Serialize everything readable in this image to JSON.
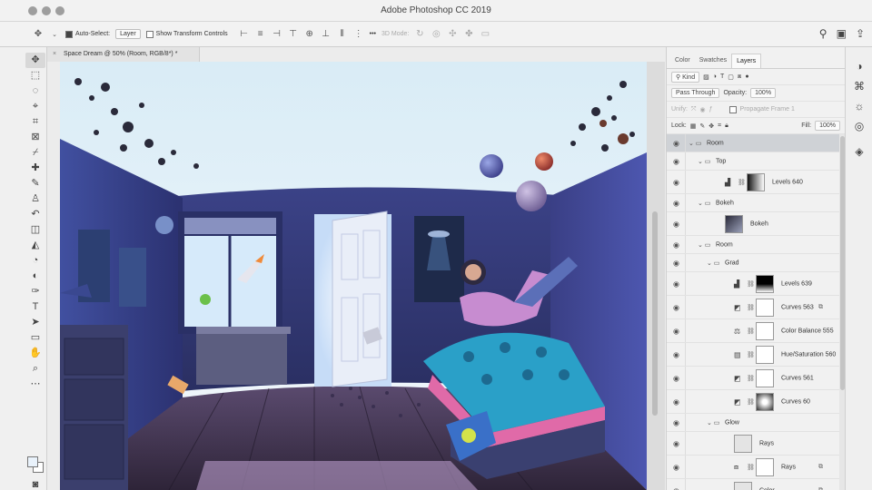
{
  "window": {
    "title": "Adobe Photoshop CC 2019"
  },
  "options_bar": {
    "auto_select_label": "Auto-Select:",
    "auto_select_value": "Layer",
    "show_transform_label": "Show Transform Controls",
    "mode_label": "3D Mode:",
    "more": "•••"
  },
  "document": {
    "tab_title": "Space Dream @ 50% (Room, RGB/8*) *"
  },
  "panel_tabs": [
    "Color",
    "Swatches",
    "Layers"
  ],
  "layers_panel": {
    "filter_label": "Kind",
    "blend_mode": "Pass Through",
    "opacity_label": "Opacity:",
    "opacity_value": "100%",
    "unify_label": "Unify:",
    "propagate_label": "Propagate Frame 1",
    "lock_label": "Lock:",
    "fill_label": "Fill:",
    "fill_value": "100%"
  },
  "layers": [
    {
      "name": "Room",
      "kind": "group",
      "depth": 0,
      "selected": true
    },
    {
      "name": "Top",
      "kind": "group",
      "depth": 1
    },
    {
      "name": "Levels 640",
      "kind": "adjustment",
      "icon": "levels-icon",
      "depth": 2,
      "thumb": "gradient"
    },
    {
      "name": "Bokeh",
      "kind": "group",
      "depth": 1
    },
    {
      "name": "Bokeh",
      "kind": "pixel",
      "depth": 2,
      "thumb": "image"
    },
    {
      "name": "Room",
      "kind": "group",
      "depth": 1
    },
    {
      "name": "Grad",
      "kind": "group",
      "depth": 2
    },
    {
      "name": "Levels 639",
      "kind": "adjustment",
      "icon": "levels-icon",
      "depth": 3,
      "thumb": "black-gradient"
    },
    {
      "name": "Curves 563",
      "kind": "adjustment",
      "icon": "curves-icon",
      "depth": 3,
      "thumb": "white",
      "fx": true
    },
    {
      "name": "Color Balance 555",
      "kind": "adjustment",
      "icon": "color-balance-icon",
      "depth": 3,
      "thumb": "white"
    },
    {
      "name": "Hue/Saturation 560",
      "kind": "adjustment",
      "icon": "hue-saturation-icon",
      "depth": 3,
      "thumb": "white"
    },
    {
      "name": "Curves 561",
      "kind": "adjustment",
      "icon": "curves-icon",
      "depth": 3,
      "thumb": "white"
    },
    {
      "name": "Curves 60",
      "kind": "adjustment",
      "icon": "curves-icon",
      "depth": 3,
      "thumb": "radial"
    },
    {
      "name": "Glow",
      "kind": "group",
      "depth": 2
    },
    {
      "name": "Rays",
      "kind": "pixel",
      "depth": 3,
      "thumb": "light"
    },
    {
      "name": "Rays",
      "kind": "smart",
      "icon": "smart-object-icon",
      "depth": 3,
      "thumb": "white",
      "fx": true
    },
    {
      "name": "Color",
      "kind": "pixel",
      "depth": 3,
      "thumb": "light",
      "fx": true
    }
  ],
  "colors": {
    "foreground": "#e9f2fb",
    "background": "#ffffff",
    "selected_row": "#cfd2d6"
  }
}
